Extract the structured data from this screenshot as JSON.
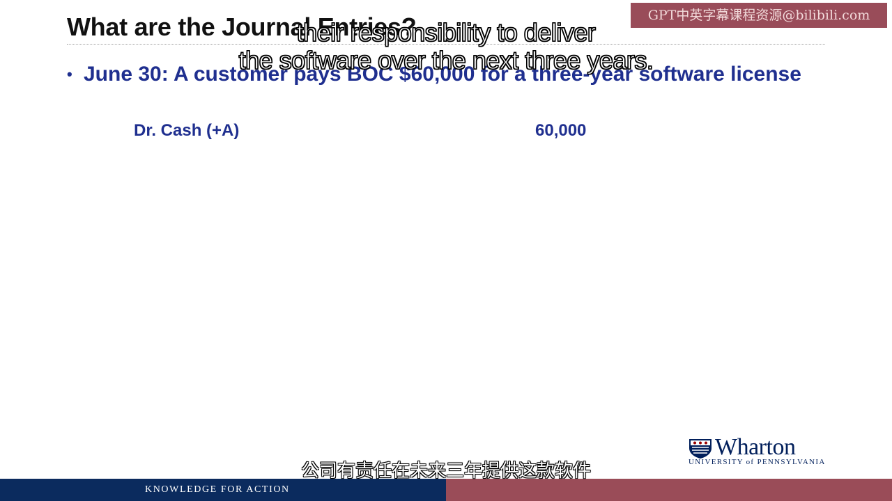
{
  "slide": {
    "title": "What are the Journal Entries?",
    "bullet": {
      "date": "June 30:",
      "text": "A customer pays BOC $60,000 for a three-year software license"
    },
    "entry": {
      "account": "Dr. Cash (+A)",
      "amount": "60,000"
    }
  },
  "watermark": {
    "text": "GPT中英字幕课程资源@bilibili.com"
  },
  "subtitles": {
    "english_line1": "their responsibility to deliver",
    "english_line2": "the software over the next three years.",
    "chinese": "公司有责任在未来三年提供这款软件"
  },
  "branding": {
    "logo_word": "Wharton",
    "logo_sub": "UNIVERSITY of PENNSYLVANIA",
    "footer_tagline": "KNOWLEDGE FOR ACTION",
    "footer_left_color": "#0b2b5e",
    "footer_right_color": "#9a4c58",
    "bullet_color": "#1f2f8f"
  }
}
